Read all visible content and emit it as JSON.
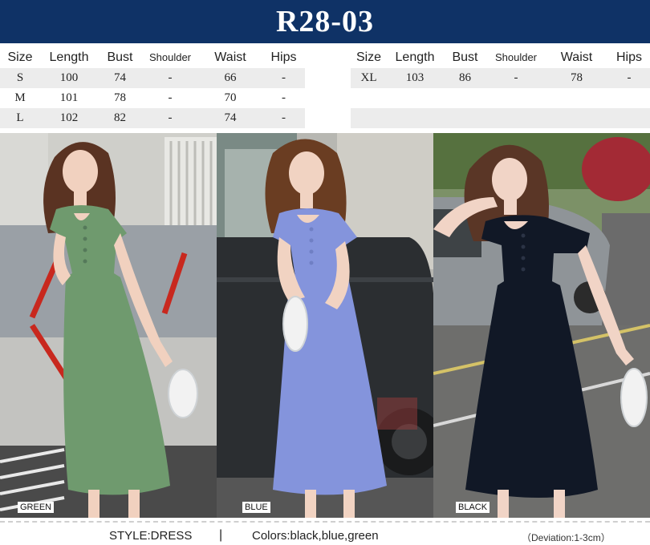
{
  "header": {
    "title": "R28-03"
  },
  "size_table": {
    "columns": [
      "Size",
      "Length",
      "Bust",
      "Shoulder",
      "Waist",
      "Hips"
    ],
    "left_rows": [
      [
        "S",
        "100",
        "74",
        "-",
        "66",
        "-"
      ],
      [
        "M",
        "101",
        "78",
        "-",
        "70",
        "-"
      ],
      [
        "L",
        "102",
        "82",
        "-",
        "74",
        "-"
      ]
    ],
    "right_rows": [
      [
        "XL",
        "103",
        "86",
        "-",
        "78",
        "-"
      ]
    ]
  },
  "photos": [
    {
      "label": "GREEN",
      "dress_color": "#6f9a6e",
      "bg_color": "#b9b9b4"
    },
    {
      "label": "BLUE",
      "dress_color": "#8494dc",
      "bg_color": "#3a3d40"
    },
    {
      "label": "BLACK",
      "dress_color": "#111826",
      "bg_color": "#8a8f8a"
    }
  ],
  "footer": {
    "style": "STYLE:DRESS",
    "separator": "|",
    "colors": "Colors:black,blue,green",
    "deviation": "（Deviation:1-3cm）"
  }
}
